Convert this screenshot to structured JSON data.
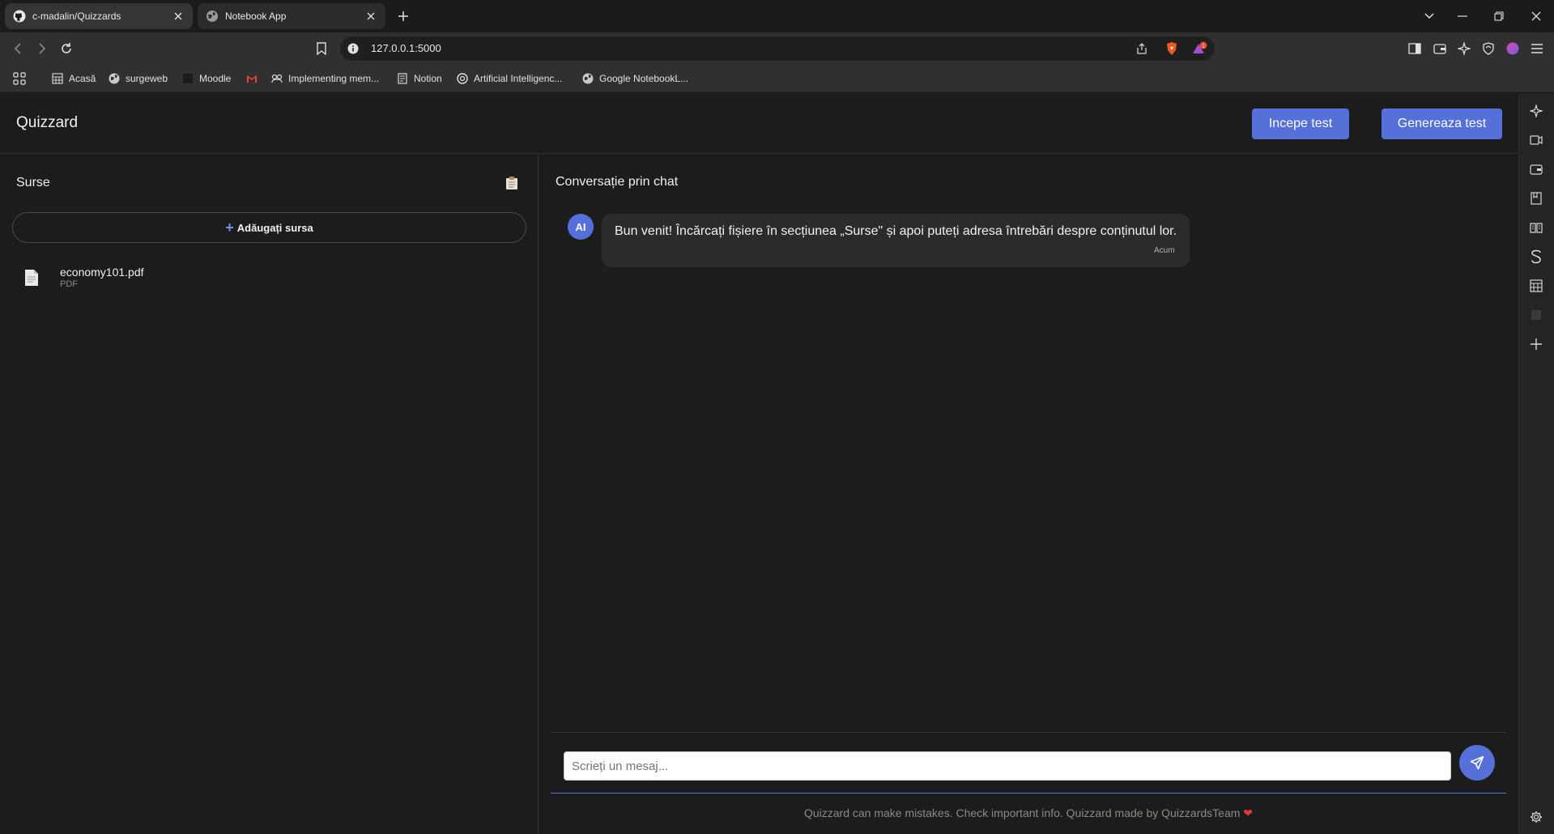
{
  "browser": {
    "tabs": [
      {
        "title": "c-madalin/Quizzards",
        "active": true
      },
      {
        "title": "Notebook App",
        "active": false
      }
    ],
    "url": "127.0.0.1:5000",
    "notification_count": "1",
    "bookmarks": [
      "Acasă",
      "surgeweb",
      "Moodle",
      "Implementing mem...",
      "Notion",
      "Artificial Intelligenc...",
      "Google NotebookL..."
    ]
  },
  "header": {
    "brand": "Quizzard",
    "start_test": "Incepe test",
    "generate_test": "Genereaza test"
  },
  "sources": {
    "title": "Surse",
    "add_label": "Adăugați sursa",
    "files": [
      {
        "name": "economy101.pdf",
        "type": "PDF"
      }
    ]
  },
  "chat": {
    "title": "Conversație prin chat",
    "messages": [
      {
        "avatar": "AI",
        "text": "Bun venit! Încărcați fișiere în secțiunea „Surse\" și apoi puteți adresa întrebări despre conținutul lor.",
        "time": "Acum"
      }
    ],
    "input_placeholder": "Scrieți un mesaj...",
    "footer": "Quizzard can make mistakes. Check important info. Quizzard made by QuizzardsTeam"
  },
  "colors": {
    "accent": "#5570d8",
    "background": "#1c1c1c",
    "bubble": "#2b2b2b"
  }
}
